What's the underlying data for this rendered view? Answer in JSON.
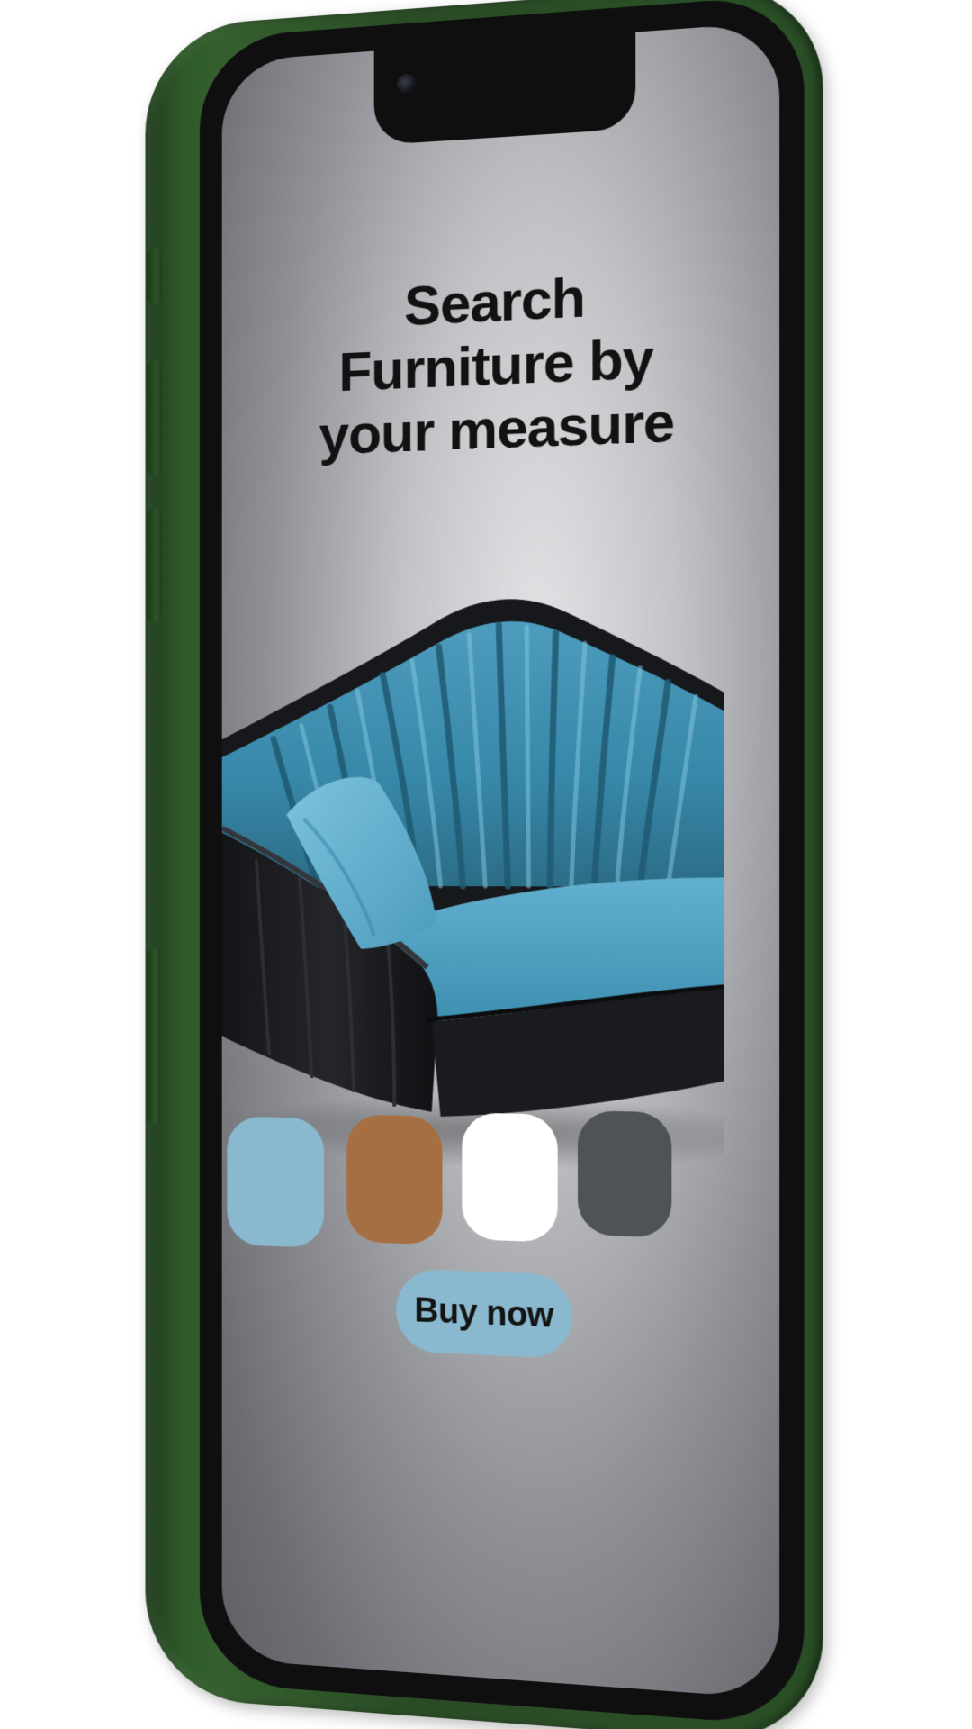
{
  "screen": {
    "headline_line1": "Search",
    "headline_line2": "Furniture by",
    "headline_line3": "your measure",
    "buy_label": "Buy now"
  },
  "colors": {
    "phone_frame": "#2f5b29",
    "bezel": "#0f0f10",
    "swatch_blue": "#8ab9cf",
    "swatch_brown": "#a66f43",
    "swatch_white": "#ffffff",
    "swatch_gray": "#4f5257",
    "button_bg": "#8ab9cf"
  },
  "swatches": [
    {
      "name": "blue",
      "color": "#8ab9cf"
    },
    {
      "name": "brown",
      "color": "#a66f43"
    },
    {
      "name": "white",
      "color": "#ffffff"
    },
    {
      "name": "gray",
      "color": "#4f5257"
    }
  ],
  "product_image": "blue-channel-tufted-sofa"
}
